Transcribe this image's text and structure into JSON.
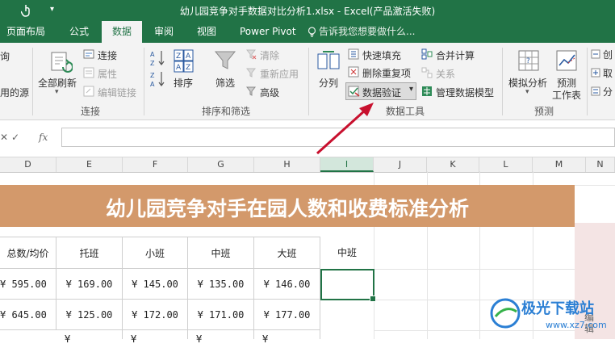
{
  "window": {
    "title": "幼儿园竞争对手数据对比分析1.xlsx - Excel(产品激活失败)"
  },
  "tabs": [
    {
      "label": "页面布局"
    },
    {
      "label": "公式"
    },
    {
      "label": "数据",
      "active": true
    },
    {
      "label": "审阅"
    },
    {
      "label": "视图"
    },
    {
      "label": "Power Pivot"
    }
  ],
  "tell_me": "告诉我您想要做什么...",
  "ribbon": {
    "get_data": {
      "line1": "询",
      "line2": "用的源"
    },
    "connections": {
      "refresh_all": "全部刷新",
      "connections": "连接",
      "properties": "属性",
      "edit_links": "编辑链接",
      "group_label": "连接"
    },
    "sort_filter": {
      "sort": "排序",
      "filter": "筛选",
      "clear": "清除",
      "reapply": "重新应用",
      "advanced": "高级",
      "group_label": "排序和筛选"
    },
    "data_tools": {
      "text_to_columns": "分列",
      "flash_fill": "快速填充",
      "remove_duplicates": "删除重复项",
      "data_validation": "数据验证",
      "consolidate": "合并计算",
      "relationships": "关系",
      "manage_data_model": "管理数据模型",
      "group_label": "数据工具"
    },
    "forecast": {
      "what_if": "模拟分析",
      "forecast_sheet_line1": "预测",
      "forecast_sheet_line2": "工作表",
      "group_label": "预测"
    },
    "outline": {
      "item1": "创",
      "item2": "取",
      "item3": "分"
    }
  },
  "formula_bar": {
    "fx": "fx",
    "value": ""
  },
  "columns": [
    "D",
    "E",
    "F",
    "G",
    "H",
    "I",
    "J",
    "K",
    "L",
    "M",
    "N"
  ],
  "selected_column": "I",
  "sheet": {
    "banner": "幼儿园竞争对手在园人数和收费标准分析",
    "headers": [
      "总数/均价",
      "托班",
      "小班",
      "中班",
      "大班",
      "中班"
    ],
    "rows": [
      [
        "¥  595.00",
        "¥  169.00",
        "¥  145.00",
        "¥  135.00",
        "¥  146.00",
        ""
      ],
      [
        "¥  645.00",
        "¥  125.00",
        "¥  172.00",
        "¥  171.00",
        "¥  177.00",
        ""
      ]
    ],
    "partial_row": [
      "¥",
      "¥",
      "¥",
      "¥"
    ],
    "side_text": "编辑"
  },
  "watermark": {
    "title": "极光下载站",
    "url": "www.xz7.com"
  },
  "colors": {
    "accent": "#217346",
    "banner": "#d3996b",
    "arrow": "#c8102e"
  }
}
